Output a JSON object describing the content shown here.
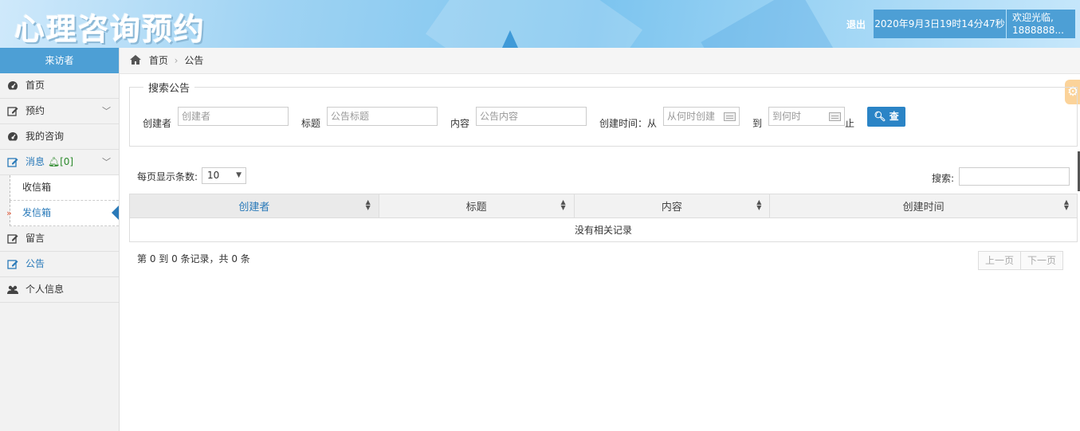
{
  "header": {
    "logo": "心理咨询预约",
    "logout": "退出",
    "datetime": "2020年9月3日19时14分47秒",
    "welcome_line1": "欢迎光临,",
    "welcome_line2": "1888888..."
  },
  "sidebar": {
    "title": "来访者",
    "items": [
      {
        "label": "首页",
        "icon": "dashboard-icon"
      },
      {
        "label": "预约",
        "icon": "edit-icon",
        "expandable": true
      },
      {
        "label": "我的咨询",
        "icon": "dashboard-icon"
      },
      {
        "label": "消息",
        "icon": "edit-icon",
        "expandable": true,
        "badge": "[0]"
      },
      {
        "label": "收信箱",
        "sub": true
      },
      {
        "label": "发信箱",
        "sub": true,
        "active": true
      },
      {
        "label": "留言",
        "icon": "edit-icon"
      },
      {
        "label": "公告",
        "icon": "edit-icon"
      },
      {
        "label": "个人信息",
        "icon": "users-icon"
      }
    ]
  },
  "breadcrumb": {
    "home": "首页",
    "current": "公告"
  },
  "search_form": {
    "legend": "搜索公告",
    "creator_label": "创建者",
    "creator_placeholder": "创建者",
    "title_label": "标题",
    "title_placeholder": "公告标题",
    "content_label": "内容",
    "content_placeholder": "公告内容",
    "time_label": "创建时间：从",
    "from_placeholder": "从何时创建",
    "to_label": "到",
    "to_placeholder": "到何时",
    "end_label": "止",
    "query_button": "查"
  },
  "table_controls": {
    "page_size_label": "每页显示条数:",
    "page_size_value": "10",
    "search_label": "搜索:"
  },
  "table": {
    "columns": [
      "创建者",
      "标题",
      "内容",
      "创建时间"
    ],
    "empty_message": "没有相关记录"
  },
  "footer": {
    "records_info": "第 0 到 0 条记录，共 0 条",
    "prev": "上一页",
    "next": "下一页"
  },
  "colors": {
    "accent": "#4d9fd5",
    "active": "#2a7ab9",
    "button": "#2b84c6"
  }
}
